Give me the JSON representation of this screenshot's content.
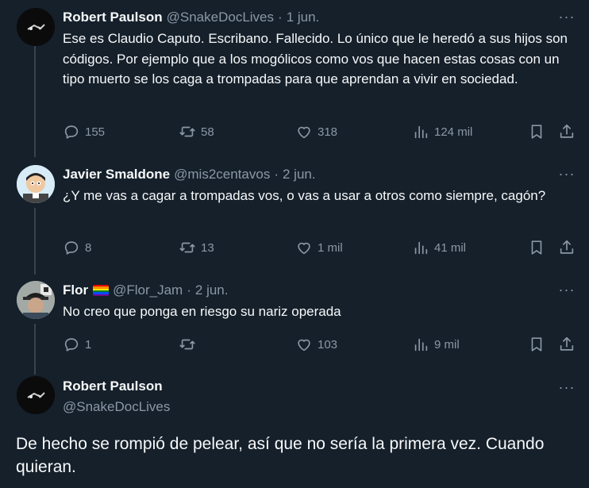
{
  "tweets": [
    {
      "name": "Robert Paulson",
      "handle": "@SnakeDocLives",
      "sep": "·",
      "date": "1 jun.",
      "text": "Ese es Claudio Caputo. Escribano. Fallecido. Lo único que le heredó a sus hijos son códigos. Por ejemplo que a los mogólicos como vos que hacen estas cosas con un tipo muerto se los caga a trompadas para que aprendan a vivir en sociedad.",
      "replies": "155",
      "reposts": "58",
      "likes": "318",
      "views": "124 mil"
    },
    {
      "name": "Javier Smaldone",
      "handle": "@mis2centavos",
      "sep": "·",
      "date": "2 jun.",
      "text": "¿Y me vas a cagar a trompadas vos, o vas a usar a otros como siempre, cagón?",
      "replies": "8",
      "reposts": "13",
      "likes": "1 mil",
      "views": "41 mil"
    },
    {
      "name": "Flor",
      "handle": "@Flor_Jam",
      "sep": "·",
      "date": "2 jun.",
      "text": "No creo que ponga en riesgo su nariz operada",
      "replies": "1",
      "reposts": "",
      "likes": "103",
      "views": "9 mil"
    }
  ],
  "main_tweet": {
    "name": "Robert Paulson",
    "handle": "@SnakeDocLives",
    "text": "De hecho se rompió de pelear, así que no sería la primera vez. Cuando quieran."
  },
  "icons": {
    "more": "more-dots-icon",
    "reply": "reply-icon",
    "repost": "repost-icon",
    "like": "like-icon",
    "views": "views-icon",
    "bookmark": "bookmark-icon",
    "share": "share-icon"
  },
  "colors": {
    "background": "#15202b",
    "text": "#f7f9f9",
    "secondary": "#8b98a5",
    "thread_line": "#38444d"
  }
}
